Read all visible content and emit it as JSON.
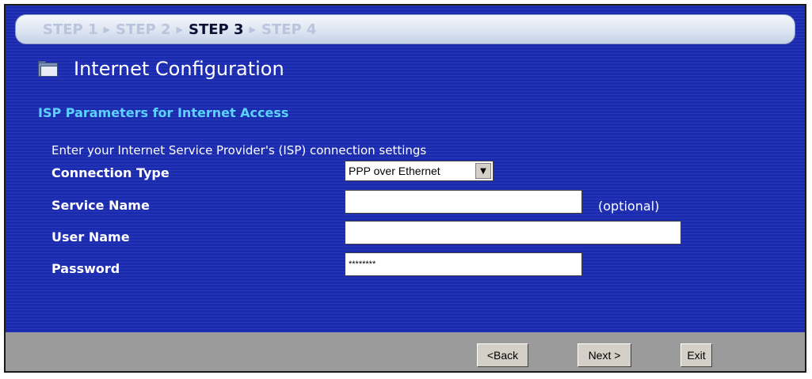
{
  "steps": [
    {
      "label": "STEP 1",
      "active": false
    },
    {
      "label": "STEP 2",
      "active": false
    },
    {
      "label": "STEP 3",
      "active": true
    },
    {
      "label": "STEP 4",
      "active": false
    }
  ],
  "page": {
    "title": "Internet Configuration",
    "subtitle": "ISP Parameters for Internet Access",
    "intro": "Enter your Internet Service Provider's (ISP) connection settings"
  },
  "form": {
    "connection_type_label": "Connection Type",
    "connection_type_value": "PPP over Ethernet",
    "service_name_label": "Service Name",
    "service_name_value": "",
    "optional_note": "(optional)",
    "user_name_label": "User Name",
    "user_name_value": "",
    "password_label": "Password",
    "password_value": "********"
  },
  "buttons": {
    "back": "<Back",
    "next": "Next >",
    "exit": "Exit"
  },
  "icons": {
    "folder": "folder-icon",
    "dropdown": "dropdown-arrow-icon"
  },
  "colors": {
    "background": "#1a2bb0",
    "subtitle": "#5cd3ff",
    "footer": "#9b9b9b"
  }
}
